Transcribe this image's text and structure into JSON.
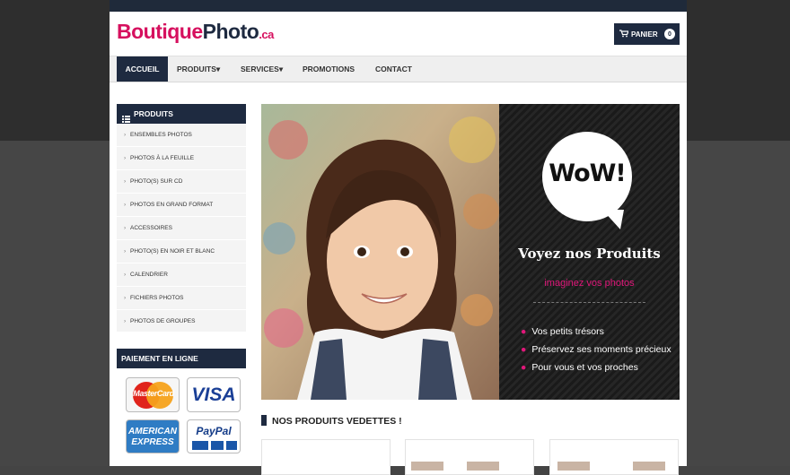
{
  "logo": {
    "part1": "Boutique",
    "part2": "Photo",
    "part3": ".ca"
  },
  "cart": {
    "label": "PANIER",
    "count": "0"
  },
  "nav": [
    {
      "label": "ACCUEIL"
    },
    {
      "label": "PRODUITS▾"
    },
    {
      "label": "SERVICES▾"
    },
    {
      "label": "PROMOTIONS"
    },
    {
      "label": "CONTACT"
    }
  ],
  "sidebar": {
    "title": "PRODUITS",
    "items": [
      {
        "label": "ENSEMBLES PHOTOS"
      },
      {
        "label": "PHOTOS À LA FEUILLE"
      },
      {
        "label": "PHOTO(S) SUR CD"
      },
      {
        "label": "PHOTOS EN GRAND FORMAT"
      },
      {
        "label": "ACCESSOIRES"
      },
      {
        "label": "PHOTO(S) EN NOIR ET BLANC"
      },
      {
        "label": "CALENDRIER"
      },
      {
        "label": "FICHIERS PHOTOS"
      },
      {
        "label": "PHOTOS DE GROUPES"
      }
    ]
  },
  "payment": {
    "title": "PAIEMENT EN LIGNE",
    "cards": {
      "mastercard": "MasterCard",
      "visa": "VISA",
      "amex1": "AMERICAN",
      "amex2": "EXPRESS",
      "paypal": "PayPal"
    }
  },
  "banner": {
    "bubble": "WoW!",
    "headline": "Voyez nos Produits",
    "tagline": "imaginez vos photos",
    "bullets": [
      "Vos petits trésors",
      "Préservez ses moments précieux",
      "Pour vous et vos proches"
    ]
  },
  "featured": {
    "title": "NOS PRODUITS VEDETTES !"
  },
  "colors": {
    "navy": "#1e2a40",
    "pink": "#d6105e"
  }
}
